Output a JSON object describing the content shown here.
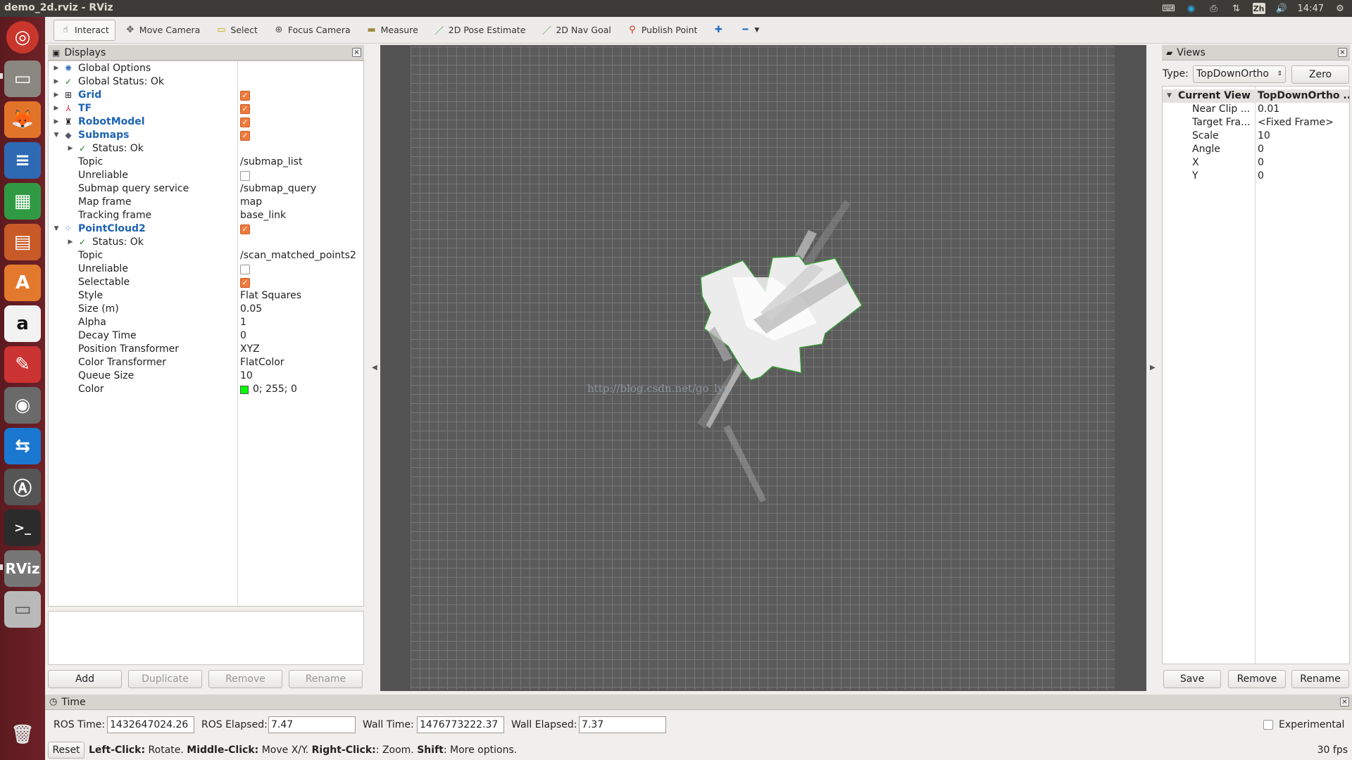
{
  "window": {
    "title": "demo_2d.rviz - RViz"
  },
  "system_tray": {
    "ime": "Zh",
    "clock": "14:47"
  },
  "toolbar": {
    "tools": [
      {
        "label": "Interact",
        "icon": "hand-icon",
        "active": true
      },
      {
        "label": "Move Camera",
        "icon": "move-camera-icon"
      },
      {
        "label": "Select",
        "icon": "select-icon"
      },
      {
        "label": "Focus Camera",
        "icon": "focus-camera-icon"
      },
      {
        "label": "Measure",
        "icon": "measure-icon"
      },
      {
        "label": "2D Pose Estimate",
        "icon": "pose-estimate-icon"
      },
      {
        "label": "2D Nav Goal",
        "icon": "nav-goal-icon"
      },
      {
        "label": "Publish Point",
        "icon": "publish-point-icon"
      }
    ]
  },
  "displays": {
    "title": "Displays",
    "rows": [
      {
        "label": "Global Options"
      },
      {
        "label": "Global Status: Ok"
      },
      {
        "label": "Grid"
      },
      {
        "label": "TF"
      },
      {
        "label": "RobotModel"
      },
      {
        "label": "Submaps"
      },
      {
        "label": "Status: Ok"
      },
      {
        "label": "Topic",
        "value": "/submap_list"
      },
      {
        "label": "Unreliable"
      },
      {
        "label": "Submap query service",
        "value": "/submap_query"
      },
      {
        "label": "Map frame",
        "value": "map"
      },
      {
        "label": "Tracking frame",
        "value": "base_link"
      },
      {
        "label": "PointCloud2"
      },
      {
        "label": "Status: Ok"
      },
      {
        "label": "Topic",
        "value": "/scan_matched_points2"
      },
      {
        "label": "Unreliable"
      },
      {
        "label": "Selectable"
      },
      {
        "label": "Style",
        "value": "Flat Squares"
      },
      {
        "label": "Size (m)",
        "value": "0.05"
      },
      {
        "label": "Alpha",
        "value": "1"
      },
      {
        "label": "Decay Time",
        "value": "0"
      },
      {
        "label": "Position Transformer",
        "value": "XYZ"
      },
      {
        "label": "Color Transformer",
        "value": "FlatColor"
      },
      {
        "label": "Queue Size",
        "value": "10"
      },
      {
        "label": "Color",
        "value": "0; 255; 0",
        "swatch": "#00ff00"
      }
    ],
    "buttons": {
      "add": "Add",
      "duplicate": "Duplicate",
      "remove": "Remove",
      "rename": "Rename"
    }
  },
  "viewport": {
    "watermark": "http://blog.csdn.net/go_lyp"
  },
  "views": {
    "title": "Views",
    "type_label": "Type:",
    "type_value": "TopDownOrtho",
    "zero_label": "Zero",
    "current_view": {
      "label": "Current View",
      "value": "TopDownOrtho ..."
    },
    "props": [
      {
        "key": "Near Clip ...",
        "value": "0.01"
      },
      {
        "key": "Target Fra...",
        "value": "<Fixed Frame>"
      },
      {
        "key": "Scale",
        "value": "10"
      },
      {
        "key": "Angle",
        "value": "0"
      },
      {
        "key": "X",
        "value": "0"
      },
      {
        "key": "Y",
        "value": "0"
      }
    ],
    "buttons": {
      "save": "Save",
      "remove": "Remove",
      "rename": "Rename"
    }
  },
  "time": {
    "title": "Time",
    "ros_time_label": "ROS Time:",
    "ros_time": "1432647024.26",
    "ros_elapsed_label": "ROS Elapsed:",
    "ros_elapsed": "7.47",
    "wall_time_label": "Wall Time:",
    "wall_time": "1476773222.37",
    "wall_elapsed_label": "Wall Elapsed:",
    "wall_elapsed": "7.37",
    "experimental_label": "Experimental"
  },
  "statusbar": {
    "reset_label": "Reset",
    "hint_left_key": "Left-Click:",
    "hint_left": " Rotate. ",
    "hint_middle_key": "Middle-Click:",
    "hint_middle": " Move X/Y. ",
    "hint_right_key": "Right-Click:",
    "hint_right": ": Zoom. ",
    "hint_shift_key": "Shift",
    "hint_shift": ": More options.",
    "fps": "30 fps"
  }
}
